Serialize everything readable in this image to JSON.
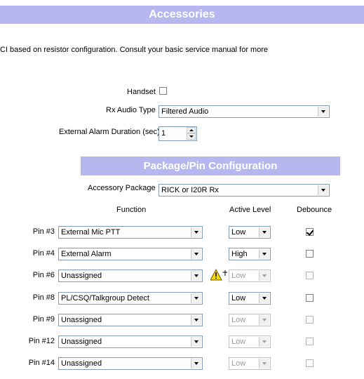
{
  "header": {
    "title": "Accessories"
  },
  "intro": {
    "text": "CI based on resistor configuration.  Consult your basic service manual for more"
  },
  "settings": {
    "handset_label": "Handset",
    "handset_checked": false,
    "rx_audio_label": "Rx Audio Type",
    "rx_audio_value": "Filtered Audio",
    "alarm_duration_label": "External Alarm Duration (sec)",
    "alarm_duration_value": "1"
  },
  "package": {
    "title": "Package/Pin Configuration",
    "accessory_label": "Accessory Package",
    "accessory_value": "RICK or I20R Rx"
  },
  "columns": {
    "function": "Function",
    "active_level": "Active Level",
    "debounce": "Debounce"
  },
  "pins": [
    {
      "label": "Pin #3",
      "function": "External Mic PTT",
      "level": "Low",
      "level_enabled": true,
      "debounce": true,
      "debounce_enabled": true,
      "warning": false
    },
    {
      "label": "Pin #4",
      "function": "External Alarm",
      "level": "High",
      "level_enabled": true,
      "debounce": false,
      "debounce_enabled": true,
      "warning": false
    },
    {
      "label": "Pin #6",
      "function": "Unassigned",
      "level": "Low",
      "level_enabled": false,
      "debounce": false,
      "debounce_enabled": false,
      "warning": true
    },
    {
      "label": "Pin #8",
      "function": "PL/CSQ/Talkgroup Detect",
      "level": "Low",
      "level_enabled": true,
      "debounce": false,
      "debounce_enabled": true,
      "warning": false
    },
    {
      "label": "Pin #9",
      "function": "Unassigned",
      "level": "Low",
      "level_enabled": false,
      "debounce": false,
      "debounce_enabled": false,
      "warning": false
    },
    {
      "label": "Pin #12",
      "function": "Unassigned",
      "level": "Low",
      "level_enabled": false,
      "debounce": false,
      "debounce_enabled": false,
      "warning": false
    },
    {
      "label": "Pin #14",
      "function": "Unassigned",
      "level": "Low",
      "level_enabled": false,
      "debounce": false,
      "debounce_enabled": false,
      "warning": false
    }
  ],
  "colors": {
    "banner": "#b7b7ef",
    "combo_border": "#7f9db9",
    "warning": "#f5d800"
  },
  "icons": {
    "warning": "warning-triangle-icon",
    "dropdown": "chevron-down-icon"
  }
}
